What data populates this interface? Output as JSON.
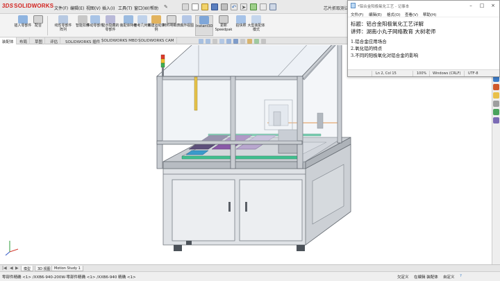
{
  "solidworks": {
    "logo_prefix": "3DS",
    "logo_text": "SOLIDWORKS",
    "document_title": "芯片抓取测试设备",
    "menu": [
      "文件(F)",
      "编辑(E)",
      "视图(V)",
      "插入(I)",
      "工具(T)",
      "窗口(W)",
      "帮助"
    ],
    "ribbon_buttons": [
      "插入零部件",
      "配合",
      "线性零部件阵列",
      "智能扣件",
      "移动零部件",
      "显示隐藏的零部件",
      "装配体特征",
      "参考几何体",
      "新建运动算例",
      "材料明细表",
      "爆炸视图",
      "Instant3D",
      "更新Speedpak",
      "拍快照",
      "大型装配体模式"
    ],
    "command_tabs": [
      "装配体",
      "布局",
      "草图",
      "评估",
      "SOLIDWORKS 插件",
      "SOLIDWORKS MBD",
      "SOLIDWORKS CAM"
    ],
    "bottom_tabs": [
      "模型",
      "3D 视图",
      "Motion Study 1"
    ],
    "status_left": "零部件精确 <1> /XXB6-940-200W-零部件精确 <1> /XXB6-940 精确 <1>",
    "status_right": [
      "欠定义",
      "在编辑 装配体",
      "自定义"
    ]
  },
  "notepad": {
    "title": "*铝合金阳极氧化工艺 - 记事本",
    "menu": [
      "文件(F)",
      "编辑(E)",
      "格式(O)",
      "查看(V)",
      "帮助(H)"
    ],
    "lines": [
      "标题：铝合金阳极氧化工艺详解",
      "讲师：湖南小丸子网络教育    大树老师",
      "1.铝合金应用场合",
      "2.氧化铝的特点",
      "3.不同的阳极氧化对铝合金的影响"
    ],
    "status": [
      "Ln 2, Col 15",
      "100%",
      "Windows (CRLF)",
      "UTF-8"
    ]
  },
  "colors": {
    "sw_red": "#d2231f",
    "frame_metal": "#c9cdd2",
    "glass_tint": "#dfe6ee",
    "rail_green": "#3fbf8f",
    "accent_orange": "#e8872d",
    "pcb_purple": "#8a5aa8"
  }
}
